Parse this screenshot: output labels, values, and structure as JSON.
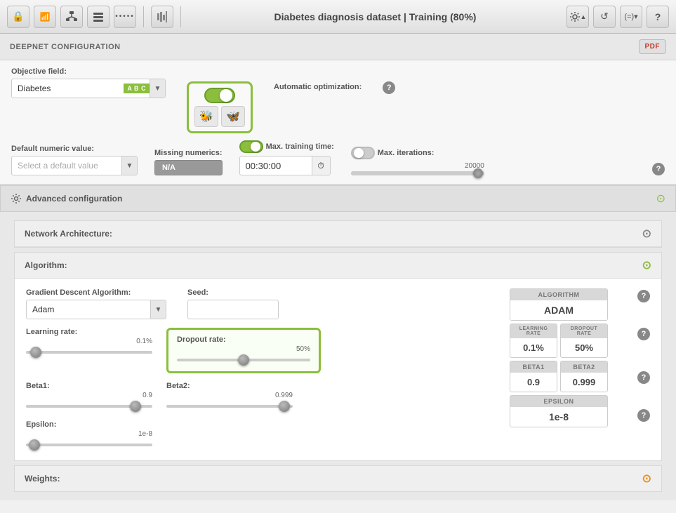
{
  "toolbar": {
    "title": "Diabetes diagnosis dataset | Training (80%)",
    "lock_icon": "🔒",
    "signal_icon": "📶",
    "network_icon": "⊞",
    "layers_icon": "⊟",
    "dots_icon": "•••••",
    "bars_icon": "|||",
    "settings_icon": "⚙",
    "refresh_icon": "↺",
    "formula_icon": "(=)",
    "help_icon": "?"
  },
  "deepnet": {
    "section_label": "DEEPNET CONFIGURATION",
    "pdf_label": "PDF",
    "objective_label": "Objective field:",
    "objective_value": "Diabetes",
    "objective_badge": "A B C",
    "auto_opt_label": "Automatic optimization:",
    "default_numeric_label": "Default numeric value:",
    "default_numeric_placeholder": "Select a default value",
    "missing_numerics_label": "Missing numerics:",
    "missing_badge": "N/A",
    "max_training_label": "Max. training time:",
    "max_training_value": "00:30:00",
    "max_iterations_label": "Max. iterations:",
    "max_iterations_value": "20000"
  },
  "advanced": {
    "label": "Advanced configuration",
    "network_arch_label": "Network Architecture:",
    "algorithm_label": "Algorithm:"
  },
  "algorithm": {
    "gradient_label": "Gradient Descent Algorithm:",
    "gradient_value": "Adam",
    "seed_label": "Seed:",
    "learning_rate_label": "Learning rate:",
    "learning_rate_value": "0.1%",
    "dropout_label": "Dropout rate:",
    "dropout_value": "50%",
    "beta1_label": "Beta1:",
    "beta1_value": "0.9",
    "beta2_label": "Beta2:",
    "beta2_value": "0.999",
    "epsilon_label": "Epsilon:",
    "epsilon_value": "1e-8"
  },
  "summary": {
    "algorithm_header": "ALGORITHM",
    "algorithm_value": "ADAM",
    "learning_rate_header": "LEARNING RATE",
    "learning_rate_value": "0.1%",
    "dropout_rate_header": "DROPOUT RATE",
    "dropout_rate_value": "50%",
    "beta1_header": "BETA1",
    "beta1_value": "0.9",
    "beta2_header": "BETA2",
    "beta2_value": "0.999",
    "epsilon_header": "EPSILON",
    "epsilon_value": "1e-8"
  },
  "weights": {
    "label": "Weights:"
  }
}
